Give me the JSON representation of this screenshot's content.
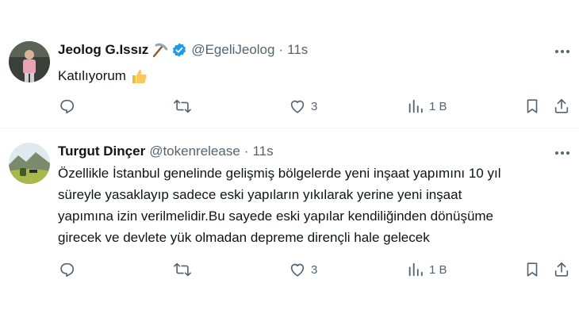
{
  "tweets": [
    {
      "name": "Jeolog G.Issız",
      "emoji_icon": "pickaxe-icon",
      "verified": true,
      "handle": "@EgeliJeolog",
      "time": "11s",
      "text": "Katılıyorum",
      "text_emoji_icon": "thumbs-up-icon",
      "likes": "3",
      "views": "1 B"
    },
    {
      "name": "Turgut Dinçer",
      "handle": "@tokenrelease",
      "time": "11s",
      "text_lines": [
        "Özellikle İstanbul genelinde gelişmiş bölgelerde yeni inşaat yapımını 10 yıl",
        "süreyle yasaklayıp sadece eski yapıların yıkılarak yerine yeni inşaat",
        "yapımına izin verilmelidir.Bu sayede eski yapılar kendiliğinden dönüşüme",
        "girecek ve devlete yük olmadan depreme dirençli hale gelecek"
      ],
      "likes": "3",
      "views": "1 B"
    }
  ],
  "separator": "·",
  "colors": {
    "text": "#0f1419",
    "secondary": "#536471",
    "verified": "#1d9bf0",
    "divider": "#eff3f4"
  }
}
